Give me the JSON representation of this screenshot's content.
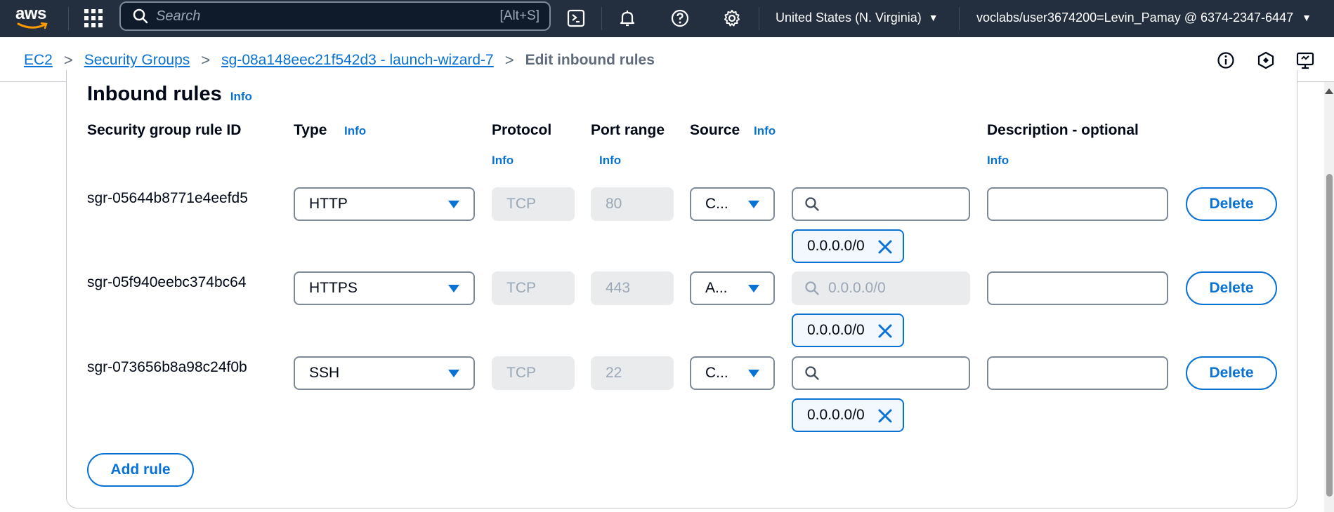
{
  "topnav": {
    "logo_text": "aws",
    "search_placeholder": "Search",
    "search_shortcut": "[Alt+S]",
    "region": "United States (N. Virginia)",
    "account": "voclabs/user3674200=Levin_Pamay @ 6374-2347-6447",
    "bg_color": "#232f3e"
  },
  "breadcrumb": {
    "items": [
      "EC2",
      "Security Groups",
      "sg-08a148eec21f542d3 - launch-wizard-7"
    ],
    "current": "Edit inbound rules"
  },
  "section": {
    "title": "Inbound rules",
    "info": "Info"
  },
  "columns": {
    "rule_id": "Security group rule ID",
    "type": "Type",
    "type_info": "Info",
    "protocol": "Protocol",
    "protocol_info": "Info",
    "port_range": "Port range",
    "port_info": "Info",
    "source": "Source",
    "source_info": "Info",
    "description": "Description - optional",
    "description_info": "Info"
  },
  "rules": [
    {
      "id": "sgr-05644b8771e4eefd5",
      "type": "HTTP",
      "protocol": "TCP",
      "port": "80",
      "source": "C...",
      "search_placeholder": "",
      "cidr": "0.0.0.0/0",
      "description": "",
      "delete": "Delete"
    },
    {
      "id": "sgr-05f940eebc374bc64",
      "type": "HTTPS",
      "protocol": "TCP",
      "port": "443",
      "source": "A...",
      "search_placeholder": "0.0.0.0/0",
      "cidr": "0.0.0.0/0",
      "description": "",
      "delete": "Delete"
    },
    {
      "id": "sgr-073656b8a98c24f0b",
      "type": "SSH",
      "protocol": "TCP",
      "port": "22",
      "source": "C...",
      "search_placeholder": "",
      "cidr": "0.0.0.0/0",
      "description": "",
      "delete": "Delete"
    }
  ],
  "add_rule": "Add rule",
  "colors": {
    "link": "#0972d3",
    "text": "#000716",
    "border": "#7d8998",
    "disabled_bg": "#e9ebed"
  }
}
